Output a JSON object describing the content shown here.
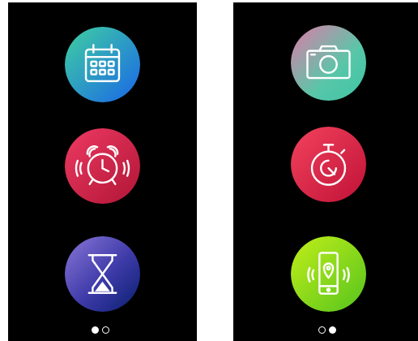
{
  "screens": [
    {
      "apps": [
        {
          "icon": "calendar-icon",
          "gradient": [
            "#39c6a0",
            "#1f6fe0"
          ]
        },
        {
          "icon": "alarm-clock-icon",
          "gradient": [
            "#e8365e",
            "#b7183a"
          ]
        },
        {
          "icon": "hourglass-timer-icon",
          "gradient": [
            "#7c6bd1",
            "#0c2a7a"
          ]
        }
      ],
      "pager": {
        "pages": 2,
        "active_page": 1
      }
    },
    {
      "apps": [
        {
          "icon": "camera-icon",
          "gradient": [
            "#d983a6",
            "#3bc6a4"
          ]
        },
        {
          "icon": "stopwatch-icon",
          "gradient": [
            "#f04060",
            "#c2123c"
          ]
        },
        {
          "icon": "find-phone-icon",
          "gradient": [
            "#b6ea1a",
            "#5fc71c"
          ]
        }
      ],
      "pager": {
        "pages": 2,
        "active_page": 2
      }
    }
  ]
}
